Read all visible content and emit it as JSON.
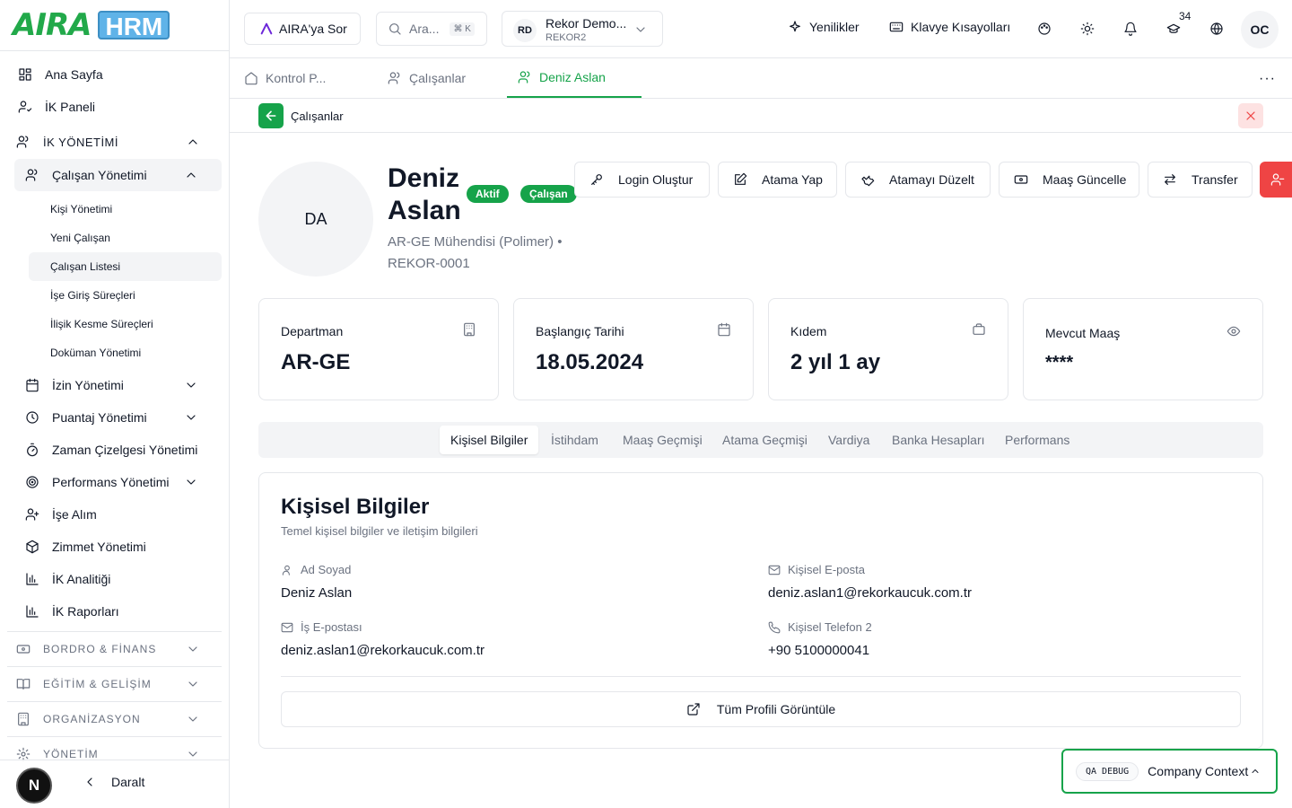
{
  "brand": {
    "logo_text": "AIRA",
    "logo_badge": "HRM"
  },
  "sidebar": {
    "items": [
      {
        "label": "Ana Sayfa",
        "icon": "dashboard-icon"
      },
      {
        "label": "İK Paneli",
        "icon": "user-check-icon"
      }
    ],
    "section_hr": "İK YÖNETİMİ",
    "employee_mgmt": "Çalışan Yönetimi",
    "sub_items": [
      "Kişi Yönetimi",
      "Yeni Çalışan",
      "Çalışan Listesi",
      "İşe Giriş Süreçleri",
      "İlişik Kesme Süreçleri",
      "Doküman Yönetimi"
    ],
    "modules": [
      "İzin Yönetimi",
      "Puantaj Yönetimi",
      "Zaman Çizelgesi Yönetimi",
      "Performans Yönetimi",
      "İşe Alım",
      "Zimmet Yönetimi",
      "İK Analitiği",
      "İK Raporları"
    ],
    "categories": [
      "BORDRO & FİNANS",
      "EĞİTİM & GELİŞİM",
      "ORGANİZASYON",
      "YÖNETİM"
    ],
    "footer": {
      "badge": "N",
      "collapse_label": "Daralt"
    }
  },
  "topbar": {
    "ask_label": "AIRA'ya Sor",
    "search_placeholder": "Ara...",
    "search_shortcut": "⌘ K",
    "company": {
      "initials": "RD",
      "name": "Rekor Demo...",
      "code": "REKOR2"
    },
    "news_label": "Yenilikler",
    "shortcuts_label": "Klavye Kısayolları",
    "notif_count": "34",
    "user_initials": "OC"
  },
  "page_tabs": [
    {
      "label": "Kontrol P...",
      "active": false
    },
    {
      "label": "Çalışanlar",
      "active": false
    },
    {
      "label": "Deniz Aslan",
      "active": true
    }
  ],
  "breadcrumb": {
    "label": "Çalışanlar"
  },
  "profile": {
    "initials": "DA",
    "name": "Deniz Aslan",
    "badges": [
      "Aktif",
      "Çalışan"
    ],
    "title_line": "AR-GE Mühendisi (Polimer) •",
    "code": "REKOR-0001",
    "actions": [
      "Login Oluştur",
      "Atama Yap",
      "Atamayı Düzelt",
      "Maaş Güncelle",
      "Transfer"
    ]
  },
  "cards": [
    {
      "label": "Departman",
      "value": "AR-GE"
    },
    {
      "label": "Başlangıç Tarihi",
      "value": "18.05.2024"
    },
    {
      "label": "Kıdem",
      "value": "2 yıl 1 ay"
    },
    {
      "label": "Mevcut Maaş",
      "value": "****"
    }
  ],
  "sub_tabs": [
    "Kişisel Bilgiler",
    "İstihdam",
    "Maaş Geçmişi",
    "Atama Geçmişi",
    "Vardiya",
    "Banka Hesapları",
    "Performans"
  ],
  "personal": {
    "title": "Kişisel Bilgiler",
    "desc": "Temel kişisel bilgiler ve iletişim bilgileri",
    "fields": [
      {
        "label": "Ad Soyad",
        "value": "Deniz Aslan"
      },
      {
        "label": "Kişisel E-posta",
        "value": "deniz.aslan1@rekorkaucuk.com.tr"
      },
      {
        "label": "İş E-postası",
        "value": "deniz.aslan1@rekorkaucuk.com.tr"
      },
      {
        "label": "Kişisel Telefon 2",
        "value": "+90 5100000041"
      }
    ],
    "full_profile": "Tüm Profili Görüntüle"
  },
  "debug": {
    "tag": "QA DEBUG",
    "context": "Company Context"
  },
  "colors": {
    "accent": "#16a34a",
    "danger": "#ef4444",
    "ai": "#6d28d9"
  }
}
